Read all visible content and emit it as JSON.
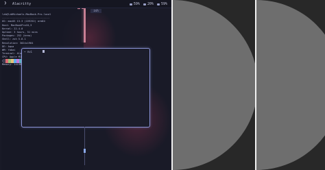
{
  "topbar": {
    "app_title": "Alacritty",
    "stats": [
      "59%",
      "20%",
      "59%"
    ]
  },
  "terminal": {
    "user_host": "lzb@lzbMichaels-MacBook-Pro.local",
    "lines": [
      "OS: macOS 13.3 (22E252) arm64",
      "Host: MacBookPro18,3",
      "Kernel: 22.4.0",
      "Uptime: 3 hours, 51 mins",
      "Packages: 252 (brew)",
      "Shell: zsh 5.8.1",
      "Resolution: 3024x1964",
      "DE: Aqua",
      "WM: Yabai",
      "Terminal: Alacritty",
      "CPU: Apple M1 Pro",
      "GPU: Apple M1 Pro",
      "Memory: 2419MiB / 16384MiB"
    ],
    "palette": [
      "#3b3b4f",
      "#e06c75",
      "#98c379",
      "#e5c07b",
      "#61afef",
      "#c678dd",
      "#56b6c2",
      "#dcdfe4",
      "#5c6370",
      "#f28b94",
      "#b5e890",
      "#f0d28e"
    ]
  },
  "tab_label": "zsh",
  "float_prompt": "~ nvi",
  "colors": {
    "accent": "#8c95d8",
    "wallpaper": "#191a27",
    "panel_bg": "#282828",
    "circle": "#6e6e6e",
    "divider": "#f2f2f2"
  }
}
